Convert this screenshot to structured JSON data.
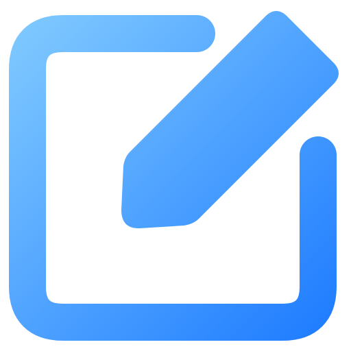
{
  "icon": {
    "name": "edit-icon",
    "semantic": "edit / compose",
    "parts": [
      "frame-square",
      "pencil"
    ]
  },
  "colors": {
    "gradient_start": "#86CEFF",
    "gradient_end": "#1877FF",
    "background": "#FFFFFF"
  }
}
